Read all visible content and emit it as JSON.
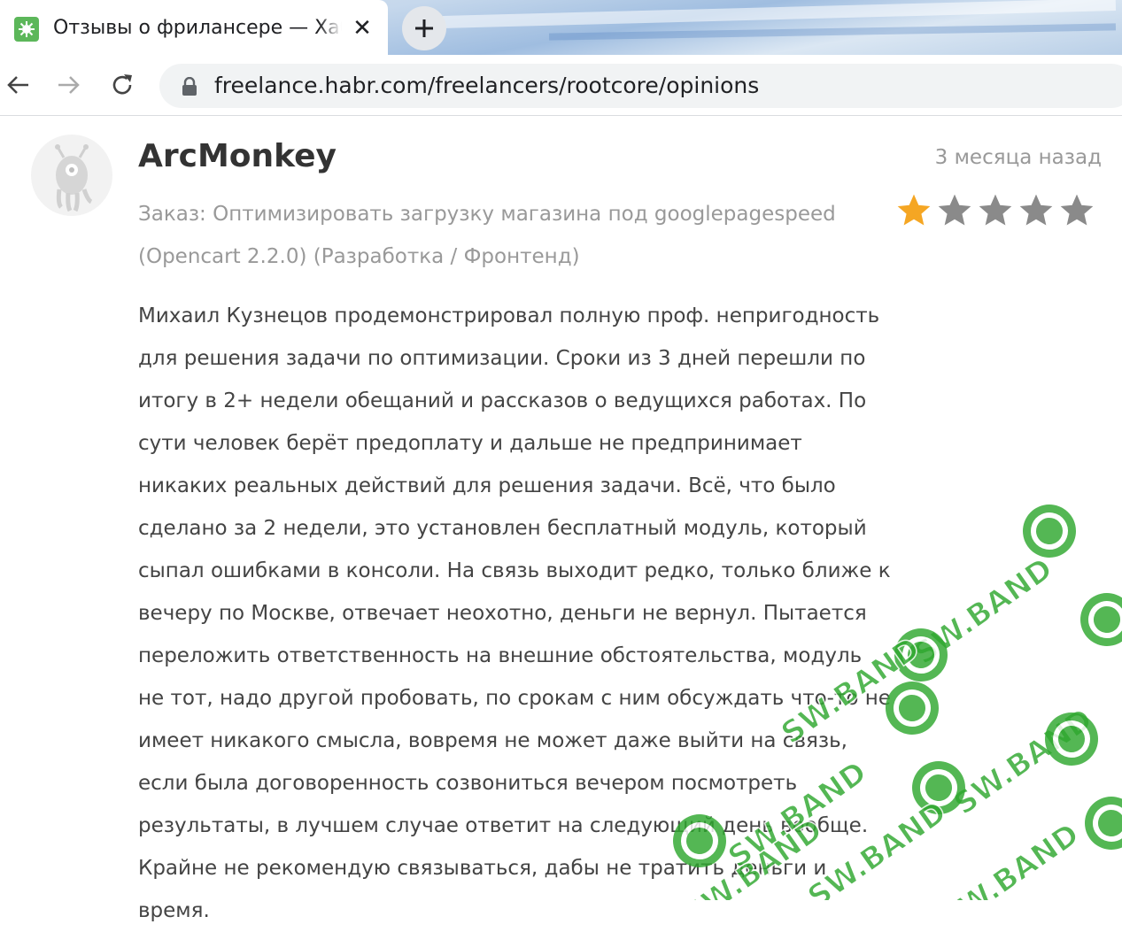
{
  "browser": {
    "tab_title": "Отзывы о фрилансере — Хабр Фриланс",
    "tab_close": "✕",
    "new_tab": "+",
    "url": "freelance.habr.com/freelancers/rootcore/opinions"
  },
  "review": {
    "author": "ArcMonkey",
    "date": "3 месяца назад",
    "order_prefix": "Заказ:",
    "order_title": "Оптимизировать загрузку магазина под googlepagespeed (Opencart 2.2.0)",
    "order_category": "(Разработка / Фронтенд)",
    "rating": 1,
    "rating_max": 5,
    "star_color_active": "#f5a623",
    "star_color_inactive": "#8a8a8a",
    "text": "Михаил Кузнецов продемонстрировал полную проф. непригодность для решения задачи по оптимизации. Сроки из 3 дней перешли по итогу в 2+ недели обещаний и рассказов о ведущихся работах. По сути человек берёт предоплату и дальше не предпринимает никаких реальных действий для решения задачи. Всё, что было сделано за 2 недели, это установлен бесплатный модуль, который сыпал ошибками в консоли. На связь выходит редко, только ближе к вечеру по Москве, отвечает неохотно, деньги не вернул. Пытается переложить ответственность на внешние обстоятельства, модуль не тот, надо другой пробовать, по срокам с ним обсуждать что-то не имеет никакого смысла, вовремя не может даже выйти на связь, если была договоренность созвониться вечером посмотреть результаты, в лучшем случае ответит на следующий день вообще. Крайне не рекомендую связываться, дабы не тратить деньги и время."
  },
  "watermark": {
    "text": "SW.BAND",
    "color": "#2fa82f"
  }
}
